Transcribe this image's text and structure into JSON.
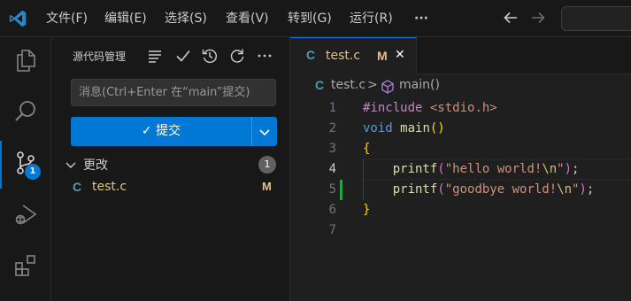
{
  "titlebar": {
    "menu": [
      "文件(F)",
      "编辑(E)",
      "选择(S)",
      "查看(V)",
      "转到(G)",
      "运行(R)"
    ],
    "more": "···"
  },
  "activity": {
    "icons": [
      "explorer-icon",
      "search-icon",
      "source-control-icon",
      "run-debug-icon",
      "extensions-icon"
    ],
    "badge": "1",
    "accent": "#0078d4"
  },
  "scm": {
    "title": "源代码管理",
    "input_placeholder": "消息(Ctrl+Enter 在“main”提交)",
    "commit_label": "✓ 提交",
    "changes_label": "更改",
    "changes_count": "1",
    "file": {
      "icon": "C",
      "name": "test.c",
      "status": "M"
    }
  },
  "editor": {
    "tab": {
      "icon": "C",
      "name": "test.c",
      "status": "M",
      "close": "✕"
    },
    "breadcrumb": {
      "file": "test.c",
      "separator": ">",
      "symbol": "main()"
    },
    "lines": [
      {
        "n": "1",
        "tokens": [
          [
            "t-kw",
            "#include"
          ],
          [
            "t-pun",
            " "
          ],
          [
            "t-str",
            "<stdio.h>"
          ]
        ]
      },
      {
        "n": "2",
        "tokens": [
          [
            "t-type",
            "void"
          ],
          [
            "t-pun",
            " "
          ],
          [
            "t-fn",
            "main"
          ],
          [
            "t-brace",
            "()"
          ]
        ]
      },
      {
        "n": "3",
        "tokens": [
          [
            "t-brace",
            "{"
          ]
        ]
      },
      {
        "n": "4",
        "tokens": [
          [
            "t-pun",
            "    "
          ],
          [
            "t-fn",
            "printf"
          ],
          [
            "t-paren",
            "("
          ],
          [
            "t-str",
            "\"hello world!"
          ],
          [
            "t-esc",
            "\\n"
          ],
          [
            "t-str",
            "\""
          ],
          [
            "t-paren",
            ")"
          ],
          [
            "t-pun",
            ";"
          ]
        ]
      },
      {
        "n": "5",
        "tokens": [
          [
            "t-pun",
            "    "
          ],
          [
            "t-fn",
            "printf"
          ],
          [
            "t-paren",
            "("
          ],
          [
            "t-str",
            "\"goodbye world!"
          ],
          [
            "t-esc",
            "\\n"
          ],
          [
            "t-str",
            "\""
          ],
          [
            "t-paren",
            ")"
          ],
          [
            "t-pun",
            ";"
          ]
        ]
      },
      {
        "n": "6",
        "tokens": [
          [
            "t-brace",
            "}"
          ]
        ]
      },
      {
        "n": "7",
        "tokens": []
      }
    ],
    "active_line": "4",
    "modified_line": "5"
  }
}
